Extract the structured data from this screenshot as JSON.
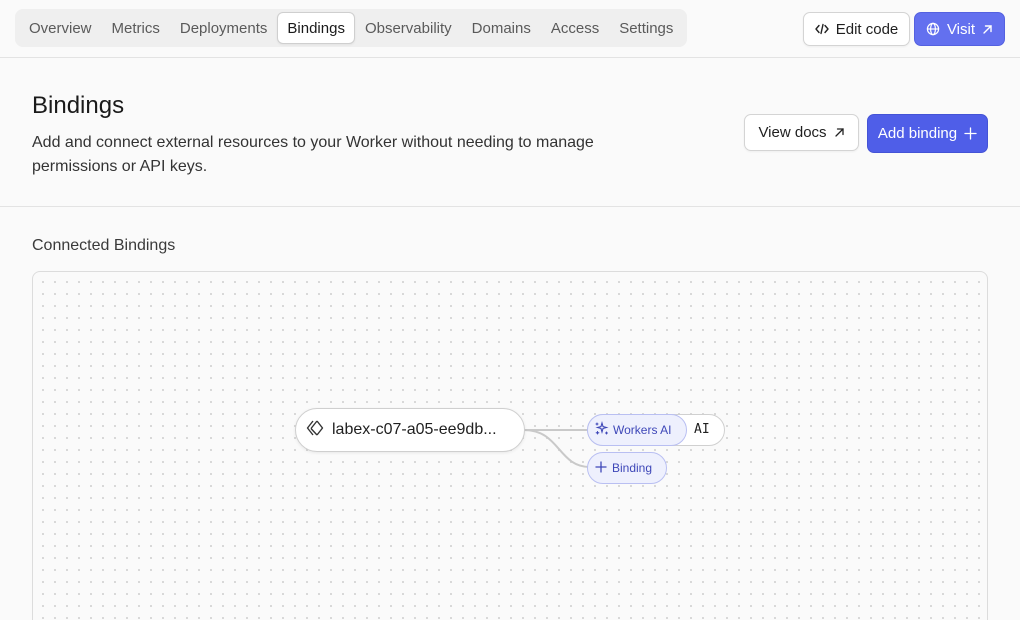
{
  "nav": {
    "tabs": [
      {
        "label": "Overview"
      },
      {
        "label": "Metrics"
      },
      {
        "label": "Deployments"
      },
      {
        "label": "Bindings",
        "active": true
      },
      {
        "label": "Observability"
      },
      {
        "label": "Domains"
      },
      {
        "label": "Access"
      },
      {
        "label": "Settings"
      }
    ],
    "edit_code_label": "Edit code",
    "visit_label": "Visit"
  },
  "header": {
    "title": "Bindings",
    "description": "Add and connect external resources to your Worker without needing to manage permissions or API keys.",
    "view_docs_label": "View docs",
    "add_binding_label": "Add binding"
  },
  "connected": {
    "section_label": "Connected Bindings",
    "worker_name": "labex-c07-a05-ee9db...",
    "bindings": [
      {
        "type": "Workers AI",
        "name": "AI"
      }
    ],
    "add_binding_label": "Binding"
  },
  "colors": {
    "accent": "#4f5ee8",
    "binding_chip_bg": "#eef0fd",
    "binding_chip_text": "#3e47b8"
  }
}
